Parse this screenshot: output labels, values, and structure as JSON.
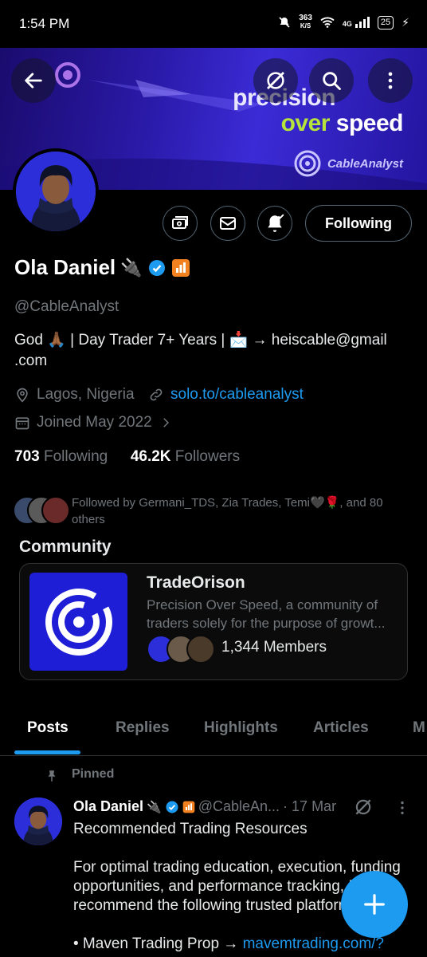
{
  "status_bar": {
    "time": "1:54 PM",
    "speed": "363",
    "speed_unit": "K/S",
    "network": "4G",
    "battery": "25"
  },
  "banner": {
    "slogan_line1": "precision",
    "slogan_line2_a": "over",
    "slogan_line2_b": "speed",
    "brand": "CableAnalyst",
    "colors": {
      "accent_green": "#b6e43a",
      "banner_blue": "#2a1aa8"
    }
  },
  "actions": {
    "following_label": "Following"
  },
  "profile": {
    "name": "Ola Daniel",
    "name_emoji": "🔌",
    "handle": "@CableAnalyst",
    "bio_line1": "God 🙏🏾 | Day Trader 7+ Years | 📩 → heiscable@gmail",
    "bio_line2": ".com",
    "location": "Lagos, Nigeria",
    "website": "solo.to/cableanalyst",
    "joined": "Joined May 2022",
    "following_count": "703",
    "following_label": "Following",
    "followers_count": "46.2K",
    "followers_label": "Followers",
    "followed_by": "Followed by Germani_TDS, Zia Trades, Temi🖤🌹, and 80 others"
  },
  "community": {
    "section_title": "Community",
    "name": "TradeOrison",
    "description": "Precision Over Speed, a community of traders solely for the purpose of growt...",
    "members": "1,344 Members"
  },
  "tabs": [
    {
      "label": "Posts",
      "active": true
    },
    {
      "label": "Replies"
    },
    {
      "label": "Highlights"
    },
    {
      "label": "Articles"
    },
    {
      "label": "M"
    }
  ],
  "post": {
    "pinned_label": "Pinned",
    "author": "Ola Daniel",
    "author_emoji": "🔌",
    "handle": "@CableAn...",
    "date": "· 17 Mar",
    "text": "Recommended Trading Resources\n\nFor optimal trading education, execution, funding opportunities, and performance tracking, I recommend the following trusted platforms:\n\n• Maven Trading Prop → ",
    "link": "mavemtrading.com/?"
  }
}
